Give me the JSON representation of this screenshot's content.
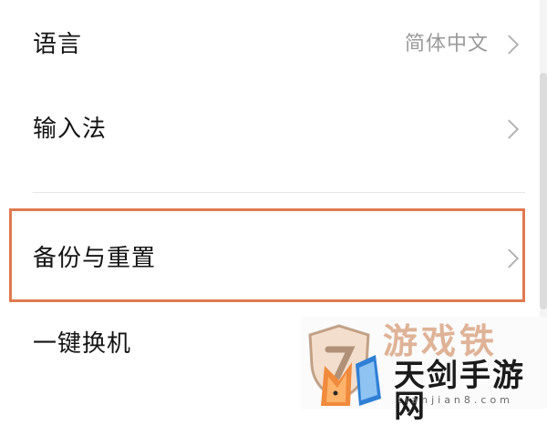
{
  "settings": {
    "items": [
      {
        "label": "语言",
        "value": "简体中文"
      },
      {
        "label": "输入法",
        "value": ""
      },
      {
        "label": "备份与重置",
        "value": ""
      },
      {
        "label": "一键换机",
        "value": ""
      }
    ]
  },
  "highlight": {
    "color": "#e07a50",
    "target": "备份与重置"
  },
  "watermark": {
    "faded_text": "游戏铁",
    "title": "天剑手游网",
    "subtitle": "tianjian8.com"
  }
}
